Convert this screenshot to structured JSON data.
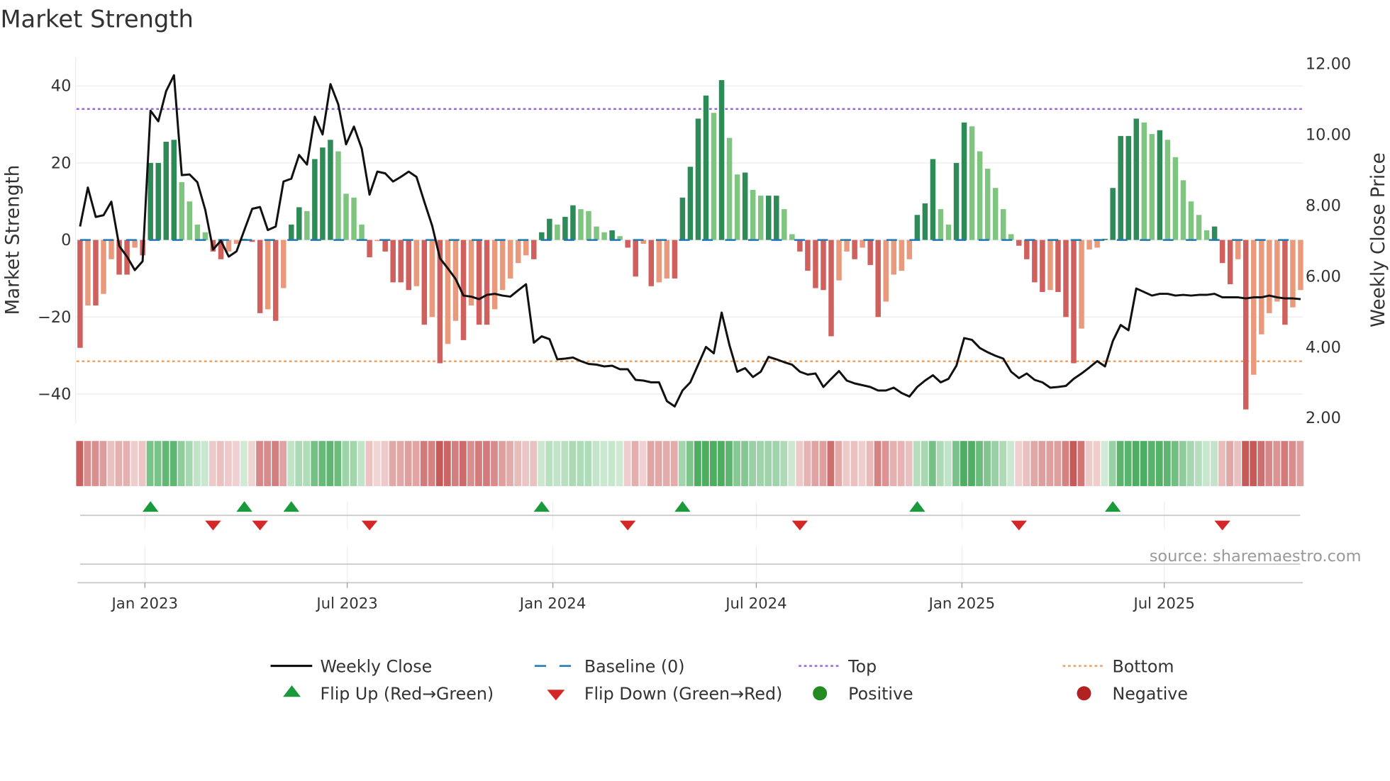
{
  "chart_data": {
    "type": "bar",
    "title": "Market Strength",
    "ylabel": "Market Strength",
    "y2label": "Weekly Close Price",
    "ylim": [
      -48,
      48
    ],
    "y2lim": [
      2.0,
      12.0
    ],
    "yticks": [
      40,
      20,
      0,
      -20,
      -40
    ],
    "ytick_labels": [
      "40",
      "20",
      "0",
      "−20",
      "−40"
    ],
    "y2ticks": [
      12,
      10,
      8,
      6,
      4,
      2
    ],
    "y2tick_labels": [
      "12.00",
      "10.00",
      "8.00",
      "6.00",
      "4.00",
      "2.00"
    ],
    "start_date": "2022-11-04",
    "frequency": "weekly",
    "xticks": [
      {
        "date": "2023-01-01",
        "label": "Jan 2023"
      },
      {
        "date": "2023-07-01",
        "label": "Jul 2023"
      },
      {
        "date": "2024-01-01",
        "label": "Jan 2024"
      },
      {
        "date": "2024-07-01",
        "label": "Jul 2024"
      },
      {
        "date": "2025-01-01",
        "label": "Jan 2025"
      },
      {
        "date": "2025-07-01",
        "label": "Jul 2025"
      }
    ],
    "top_level": 34,
    "bottom_level": -31.5,
    "baseline": 0,
    "strength": [
      -28,
      -17,
      -17,
      -14,
      -5,
      -9,
      -9,
      -2,
      -4,
      20,
      20,
      25.5,
      26,
      15,
      10,
      4,
      2,
      -3,
      -5,
      -3,
      -1,
      0.3,
      -0.5,
      -19,
      -18,
      -21,
      -12.5,
      4,
      8.5,
      7.5,
      21,
      24,
      26,
      23,
      12,
      11,
      4,
      -4.5,
      -0.3,
      -3,
      -11,
      -11,
      -13,
      -12,
      -22,
      -20,
      -32,
      -27,
      -21,
      -26,
      -17,
      -22,
      -22,
      -18,
      -13,
      -10,
      -6,
      -4,
      -5,
      2,
      5.5,
      4,
      6,
      9,
      8,
      7.5,
      3.5,
      2,
      2.5,
      1,
      -2,
      -9.5,
      -1,
      -12,
      -11,
      -10,
      -10,
      11,
      19,
      31.5,
      37.5,
      33,
      41.5,
      26.5,
      17,
      17.5,
      13,
      11.5,
      11.5,
      11.5,
      8,
      1.5,
      -3,
      -8,
      -12.5,
      -13,
      -25,
      -10.5,
      -3,
      -5,
      -2,
      -6.5,
      -20,
      -16,
      -9,
      -8,
      -5,
      6.5,
      9.5,
      21,
      8,
      4,
      20,
      30.5,
      29.5,
      23,
      18.5,
      13.5,
      8,
      1.5,
      -1.5,
      -5,
      -11,
      -13.5,
      -13,
      -13.5,
      -20,
      -32,
      -23,
      -2.5,
      -2,
      0.3,
      13.5,
      27,
      27,
      31.5,
      30.5,
      27.5,
      28.5,
      26,
      21.5,
      15.5,
      10,
      6.5,
      2.5,
      3.5,
      -6,
      -11.5,
      -5,
      -44,
      -35,
      -24.5,
      -19,
      -16,
      -22,
      -17.5,
      -13
    ],
    "weekly_close": [
      7.38,
      8.48,
      7.65,
      7.7,
      8.08,
      6.83,
      6.53,
      6.15,
      6.4,
      10.65,
      10.35,
      11.2,
      11.65,
      8.83,
      8.85,
      8.63,
      7.85,
      6.73,
      6.98,
      6.53,
      6.68,
      7.28,
      7.88,
      7.93,
      7.28,
      7.38,
      8.65,
      8.73,
      9.4,
      9.13,
      10.48,
      9.98,
      11.4,
      10.83,
      9.7,
      10.2,
      9.58,
      8.28,
      8.93,
      8.88,
      8.65,
      8.78,
      8.93,
      8.78,
      8.08,
      7.4,
      6.48,
      6.2,
      5.9,
      5.43,
      5.4,
      5.33,
      5.45,
      5.48,
      5.43,
      5.4,
      5.58,
      5.75,
      4.1,
      4.28,
      4.2,
      3.63,
      3.65,
      3.68,
      3.58,
      3.5,
      3.48,
      3.43,
      3.45,
      3.35,
      3.35,
      3.05,
      3.03,
      2.98,
      2.98,
      2.45,
      2.3,
      2.75,
      2.98,
      3.48,
      3.98,
      3.8,
      4.95,
      4.03,
      3.28,
      3.38,
      3.13,
      3.28,
      3.7,
      3.63,
      3.55,
      3.48,
      3.28,
      3.2,
      3.23,
      2.85,
      3.08,
      3.3,
      3.03,
      2.95,
      2.9,
      2.85,
      2.75,
      2.75,
      2.83,
      2.68,
      2.58,
      2.85,
      3.03,
      3.18,
      2.98,
      3.08,
      3.45,
      4.23,
      4.18,
      3.95,
      3.83,
      3.73,
      3.65,
      3.28,
      3.1,
      3.23,
      3.05,
      2.98,
      2.83,
      2.85,
      2.88,
      3.08,
      3.23,
      3.4,
      3.58,
      3.43,
      4.15,
      4.6,
      4.45,
      5.63,
      5.53,
      5.43,
      5.48,
      5.48,
      5.43,
      5.45,
      5.43,
      5.45,
      5.45,
      5.48,
      5.38,
      5.38,
      5.38,
      5.35,
      5.38,
      5.38,
      5.43,
      5.38,
      5.35,
      5.35,
      5.33
    ],
    "flip_up_weeks": [
      9,
      21,
      27,
      59,
      77,
      107,
      132
    ],
    "flip_down_weeks": [
      17,
      23,
      37,
      70,
      92,
      120,
      146
    ],
    "colors": {
      "pos_rising": "#2e8b57",
      "pos_falling": "#7fc47f",
      "neg_falling": "#d0605e",
      "neg_rising": "#e99a7c",
      "close_line": "#111111",
      "baseline": "#1f77b4",
      "top": "#9966dd",
      "bottom": "#f0a060",
      "flip_up": "#1a9a3a",
      "flip_down": "#d62728",
      "positive": "#228b22",
      "negative": "#b22222"
    },
    "legend": {
      "placement": "bottom",
      "items": [
        {
          "key": "close",
          "label": "Weekly Close"
        },
        {
          "key": "baseline",
          "label": "Baseline (0)"
        },
        {
          "key": "top",
          "label": "Top"
        },
        {
          "key": "bottom",
          "label": "Bottom"
        },
        {
          "key": "flip_up",
          "label": "Flip Up (Red→Green)"
        },
        {
          "key": "flip_down",
          "label": "Flip Down (Green→Red)"
        },
        {
          "key": "positive",
          "label": "Positive"
        },
        {
          "key": "negative",
          "label": "Negative"
        }
      ]
    },
    "source": "source: sharemaestro.com"
  }
}
